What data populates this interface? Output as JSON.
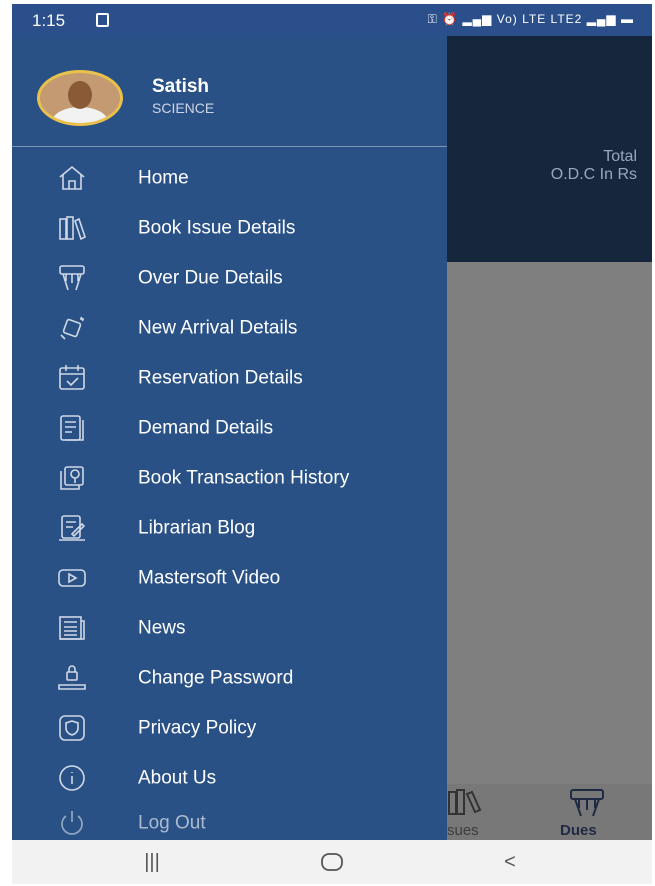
{
  "status_bar": {
    "time": "1:15",
    "indicators": "Vo) LTE LTE2"
  },
  "profile": {
    "name": "Satish",
    "department": "SCIENCE"
  },
  "menu": [
    {
      "label": "Home",
      "icon": "home-icon"
    },
    {
      "label": "Book Issue Details",
      "icon": "books-icon"
    },
    {
      "label": "Over Due Details",
      "icon": "overdue-icon"
    },
    {
      "label": "New Arrival Details",
      "icon": "new-arrival-icon"
    },
    {
      "label": "Reservation Details",
      "icon": "calendar-check-icon"
    },
    {
      "label": "Demand Details",
      "icon": "list-document-icon"
    },
    {
      "label": "Book Transaction History",
      "icon": "book-history-icon"
    },
    {
      "label": "Librarian Blog",
      "icon": "blog-icon"
    },
    {
      "label": "Mastersoft Video",
      "icon": "video-play-icon"
    },
    {
      "label": "News",
      "icon": "newspaper-icon"
    },
    {
      "label": "Change Password",
      "icon": "lock-icon"
    },
    {
      "label": "Privacy Policy",
      "icon": "shield-icon"
    },
    {
      "label": "About Us",
      "icon": "info-icon"
    },
    {
      "label": "Log Out",
      "icon": "power-icon"
    }
  ],
  "background": {
    "total_label": "Total",
    "odc_label": "O.D.C In Rs",
    "nav_issues": "sues",
    "nav_dues": "Dues"
  },
  "colors": {
    "drawer": "#2a5186",
    "status_bar": "#2a4f8a",
    "dark_panel": "#15263d"
  }
}
